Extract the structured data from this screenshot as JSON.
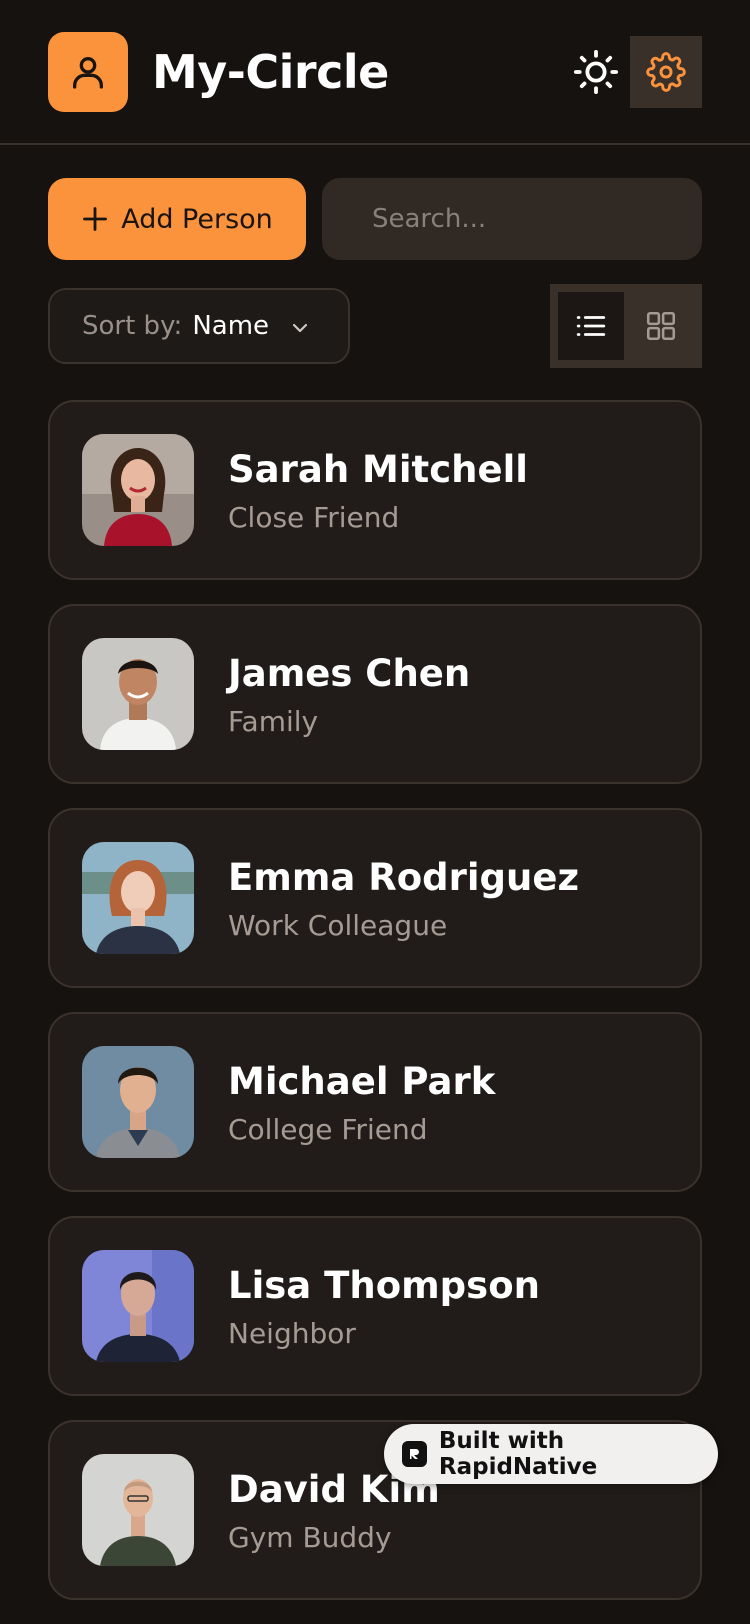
{
  "header": {
    "title": "My-Circle",
    "logo_icon": "user-icon",
    "theme_icon": "sun-icon",
    "settings_icon": "gear-icon"
  },
  "toolbar": {
    "add_label": "Add Person",
    "add_icon": "plus-icon",
    "search_placeholder": "Search...",
    "sort_label": "Sort by:",
    "sort_value": "Name",
    "view_list_icon": "list-icon",
    "view_grid_icon": "grid-icon",
    "active_view": "list"
  },
  "people": [
    {
      "name": "Sarah Mitchell",
      "relation": "Close Friend"
    },
    {
      "name": "James Chen",
      "relation": "Family"
    },
    {
      "name": "Emma Rodriguez",
      "relation": "Work Colleague"
    },
    {
      "name": "Michael Park",
      "relation": "College Friend"
    },
    {
      "name": "Lisa Thompson",
      "relation": "Neighbor"
    },
    {
      "name": "David Kim",
      "relation": "Gym Buddy"
    }
  ],
  "badge": {
    "label": "Built with RapidNative"
  },
  "colors": {
    "accent": "#fb923c",
    "background": "#161210",
    "card": "#211c19",
    "muted_text": "#a59b94"
  }
}
